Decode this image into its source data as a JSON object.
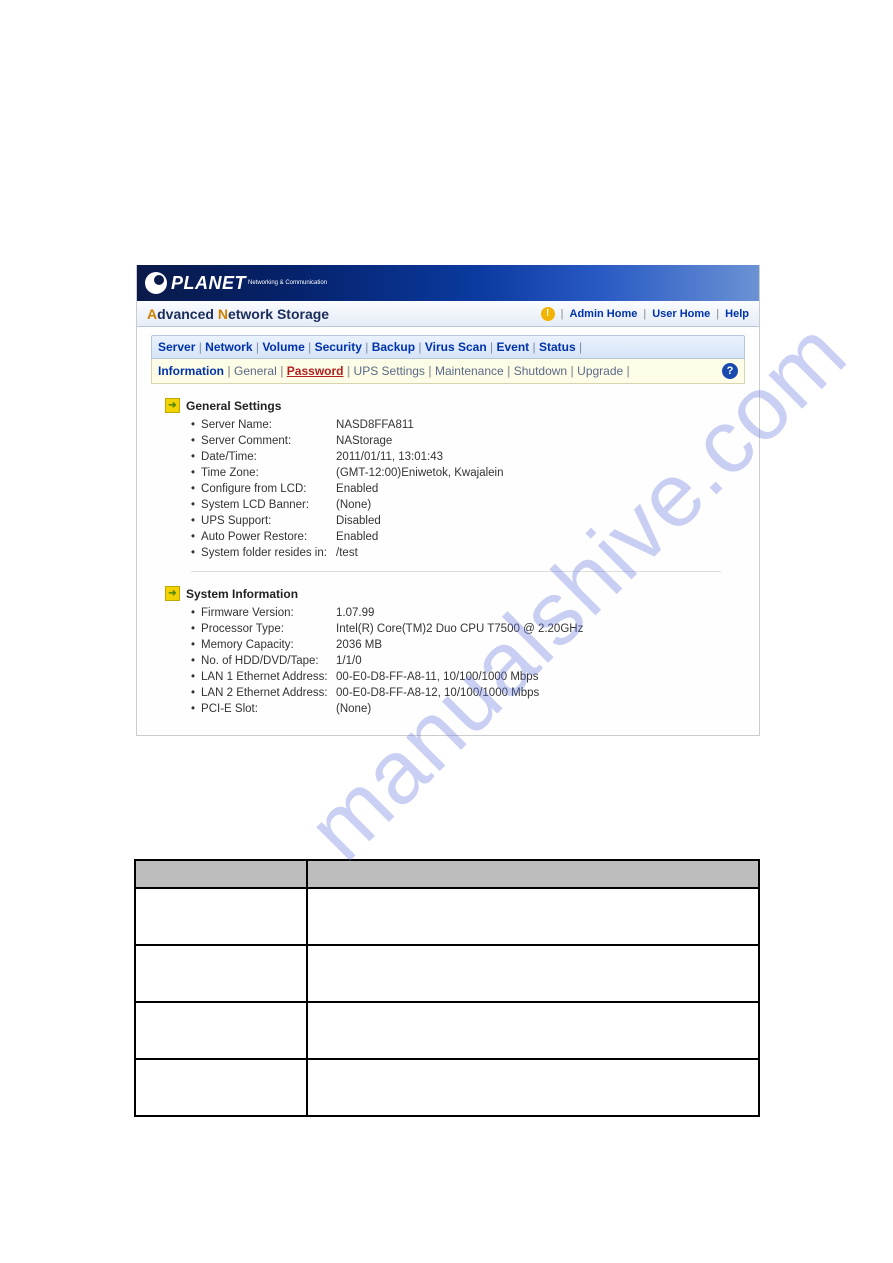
{
  "watermark": "manualshive.com",
  "logo": {
    "text": "PLANET",
    "subtitle": "Networking & Communication"
  },
  "page_title": {
    "prefix_accent": "A",
    "rest": "dvanced ",
    "bold_accent": "N",
    "rest2": "etwork Storage"
  },
  "header_links": {
    "admin_home": "Admin Home",
    "user_home": "User Home",
    "help": "Help"
  },
  "tabs": [
    "Server",
    "Network",
    "Volume",
    "Security",
    "Backup",
    "Virus Scan",
    "Event",
    "Status"
  ],
  "active_tab": "Server",
  "subtabs": {
    "active": "Information",
    "current": "Password",
    "items": [
      "Information",
      "General",
      "Password",
      "UPS Settings",
      "Maintenance",
      "Shutdown",
      "Upgrade"
    ]
  },
  "sections": {
    "general_settings": {
      "title": "General Settings",
      "rows": [
        {
          "k": "Server Name:",
          "v": "NASD8FFA811"
        },
        {
          "k": "Server Comment:",
          "v": "NAStorage"
        },
        {
          "k": "Date/Time:",
          "v": "2011/01/11, 13:01:43"
        },
        {
          "k": "Time Zone:",
          "v": "(GMT-12:00)Eniwetok, Kwajalein"
        },
        {
          "k": "Configure from LCD:",
          "v": "Enabled"
        },
        {
          "k": "System LCD Banner:",
          "v": "(None)"
        },
        {
          "k": "UPS Support:",
          "v": "Disabled"
        },
        {
          "k": "Auto Power Restore:",
          "v": "Enabled"
        },
        {
          "k": "System folder resides in:",
          "v": "/test"
        }
      ]
    },
    "system_information": {
      "title": "System Information",
      "rows": [
        {
          "k": "Firmware Version:",
          "v": "1.07.99"
        },
        {
          "k": "Processor Type:",
          "v": "Intel(R) Core(TM)2 Duo CPU T7500 @ 2.20GHz"
        },
        {
          "k": "Memory Capacity:",
          "v": "2036 MB"
        },
        {
          "k": "No. of HDD/DVD/Tape:",
          "v": "1/1/0"
        },
        {
          "k": "LAN 1 Ethernet Address:",
          "v": "00-E0-D8-FF-A8-11, 10/100/1000 Mbps"
        },
        {
          "k": "LAN 2 Ethernet Address:",
          "v": "00-E0-D8-FF-A8-12, 10/100/1000 Mbps"
        },
        {
          "k": "PCI-E Slot:",
          "v": "(None)"
        }
      ]
    }
  }
}
